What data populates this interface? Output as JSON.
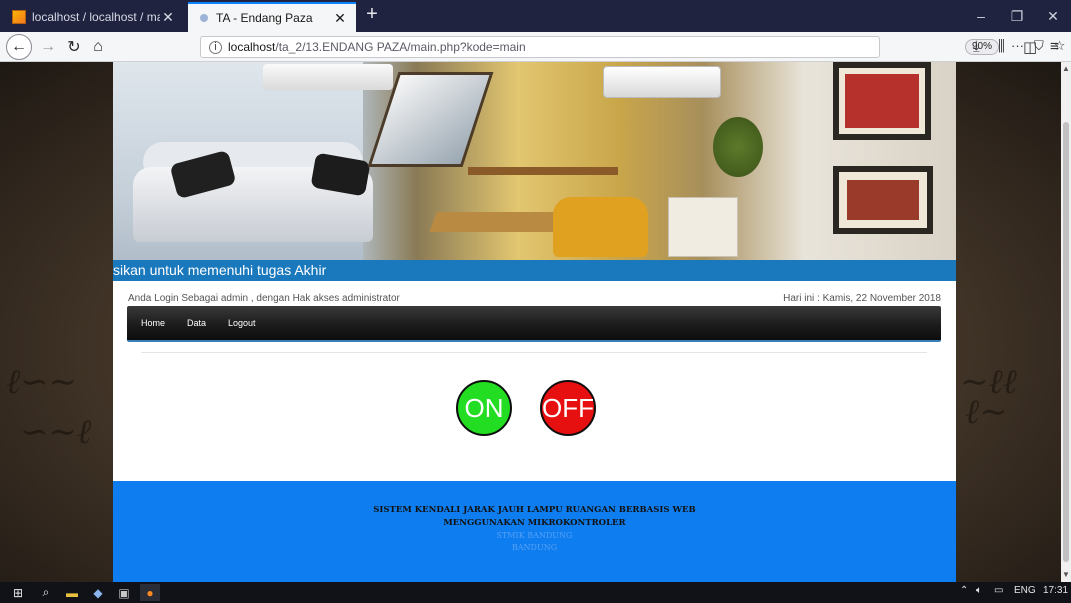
{
  "browser": {
    "tabs": [
      {
        "label": "localhost / localhost / maindb",
        "active": false
      },
      {
        "label": "TA - Endang Paza",
        "active": true
      }
    ],
    "new_tab": "+",
    "window_controls": {
      "minimize": "–",
      "restore": "❐",
      "close": "✕"
    },
    "nav": {
      "back": "←",
      "forward": "→",
      "reload": "↻",
      "home": "⌂"
    },
    "url_host": "localhost",
    "url_path": "/ta_2/13.ENDANG PAZA/main.php?kode=main",
    "zoom": "90%",
    "url_icons": {
      "more": "···",
      "pocket": "⛉",
      "bookmark": "☆"
    },
    "toolbar_icons": {
      "download": "⤓",
      "library": "⫼",
      "sidebar": "◫",
      "menu": "≡"
    }
  },
  "page": {
    "marquee_text": "sikan untuk memenuhi tugas Akhir",
    "login_text": "Anda Login Sebagai admin , dengan Hak akses administrator",
    "date_text": "Hari ini : Kamis, 22 November 2018",
    "menu": [
      "Home",
      "Data",
      "Logout"
    ],
    "on_label": "ON",
    "off_label": "OFF",
    "footer": {
      "line1": "SISTEM KENDALI JARAK JAUH LAMPU RUANGAN BERBASIS WEB",
      "line2": "MENGGUNAKAN MIKROKONTROLER",
      "line3": "STMIK BANDUNG",
      "line4": "BANDUNG"
    }
  },
  "taskbar": {
    "tray": {
      "lang": "ENG",
      "time": "17:31"
    }
  },
  "colors": {
    "accent_blue": "#1a78bd",
    "footer_blue": "#0e7df0",
    "on_green": "#22dd22",
    "off_red": "#e61010"
  }
}
